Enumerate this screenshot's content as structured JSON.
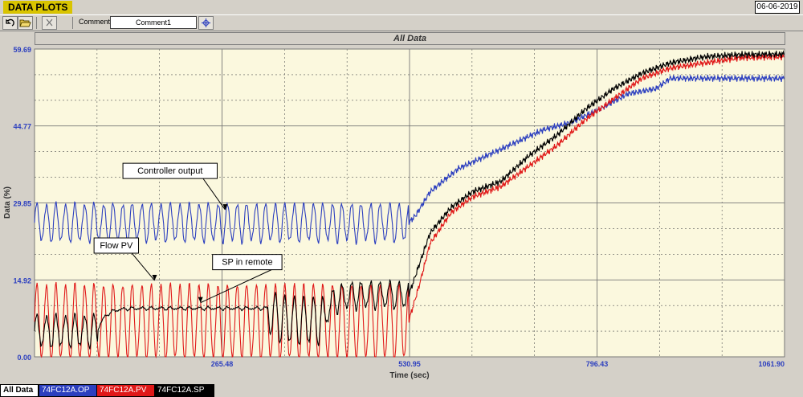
{
  "window": {
    "title": "DATA PLOTS",
    "date": "06-06-2019"
  },
  "toolbar": {
    "undo_icon": "undo-icon",
    "open_icon": "open-folder-icon",
    "close_icon": "close-icon",
    "comment_label": "Comment",
    "comment_value": "Comment1",
    "settings_icon": "cursor-settings-icon"
  },
  "tabs": [
    {
      "label": "All Data",
      "active": true,
      "color": "#ffffff"
    },
    {
      "label": "74FC12A.OP",
      "active": false,
      "color": "#2c3fbf"
    },
    {
      "label": "74FC12A.PV",
      "active": false,
      "color": "#e01818"
    },
    {
      "label": "74FC12A.SP",
      "active": false,
      "color": "#000000"
    }
  ],
  "chart_data": {
    "type": "line",
    "title": "All Data",
    "xlabel": "Time (sec)",
    "ylabel": "Data (%)",
    "xlim": [
      0,
      1061.9
    ],
    "ylim": [
      0,
      59.69
    ],
    "x_ticks": [
      "265.48",
      "530.95",
      "796.43",
      "1061.90"
    ],
    "y_ticks": [
      "0.00",
      "14.92",
      "29.85",
      "44.77",
      "59.69"
    ],
    "background": "#fbf8de",
    "grid": true,
    "annotations": [
      {
        "text": "Controller output",
        "x": 270,
        "y": 28.5
      },
      {
        "text": "Flow PV",
        "x": 170,
        "y": 14.8
      },
      {
        "text": "SP in remote",
        "x": 235,
        "y": 10.5
      }
    ],
    "series": [
      {
        "name": "74FC12A.OP",
        "color": "#2c3fbf",
        "oscillation": {
          "x_start": 0,
          "x_end": 530,
          "center": 26.0,
          "amplitude": 3.6,
          "period": 13.5
        },
        "points": [
          [
            0,
            26
          ],
          [
            530,
            26
          ],
          [
            540,
            27.5
          ],
          [
            560,
            32
          ],
          [
            600,
            36.5
          ],
          [
            640,
            39
          ],
          [
            680,
            41.5
          ],
          [
            720,
            44
          ],
          [
            760,
            45.5
          ],
          [
            800,
            48
          ],
          [
            840,
            51
          ],
          [
            880,
            52
          ],
          [
            900,
            54
          ],
          [
            1000,
            54
          ],
          [
            1061.9,
            54
          ]
        ]
      },
      {
        "name": "74FC12A.PV",
        "color": "#e01818",
        "oscillation": {
          "x_start": 0,
          "x_end": 530,
          "center": 6.8,
          "amplitude": 7.2,
          "period": 13.5
        },
        "points": [
          [
            0,
            7
          ],
          [
            530,
            7
          ],
          [
            545,
            14
          ],
          [
            560,
            22
          ],
          [
            590,
            28
          ],
          [
            620,
            31
          ],
          [
            660,
            33
          ],
          [
            700,
            37
          ],
          [
            740,
            41
          ],
          [
            780,
            46
          ],
          [
            820,
            50
          ],
          [
            860,
            54
          ],
          [
            900,
            56
          ],
          [
            950,
            57
          ],
          [
            1000,
            58
          ],
          [
            1061.9,
            58.2
          ]
        ]
      },
      {
        "name": "74FC12A.SP",
        "color": "#000000",
        "segments": [
          {
            "x_start": 0,
            "x_end": 90,
            "center": 5.0,
            "amplitude": 3.0,
            "period": 13.5
          },
          {
            "x_start": 90,
            "x_end": 330,
            "center": 9.4,
            "amplitude": 0.25,
            "period": 13.5
          },
          {
            "x_start": 330,
            "x_end": 410,
            "center": 7.0,
            "amplitude": 4.5,
            "period": 13.5
          },
          {
            "x_start": 410,
            "x_end": 530,
            "center": 12.0,
            "amplitude": 2.5,
            "period": 13.5
          }
        ],
        "points": [
          [
            0,
            5
          ],
          [
            530,
            12
          ],
          [
            545,
            18
          ],
          [
            560,
            24
          ],
          [
            590,
            29
          ],
          [
            620,
            32
          ],
          [
            660,
            34
          ],
          [
            700,
            39
          ],
          [
            740,
            43
          ],
          [
            780,
            48
          ],
          [
            820,
            52
          ],
          [
            860,
            55
          ],
          [
            900,
            57
          ],
          [
            950,
            58.2
          ],
          [
            1000,
            58.6
          ],
          [
            1061.9,
            58.7
          ]
        ]
      }
    ]
  }
}
